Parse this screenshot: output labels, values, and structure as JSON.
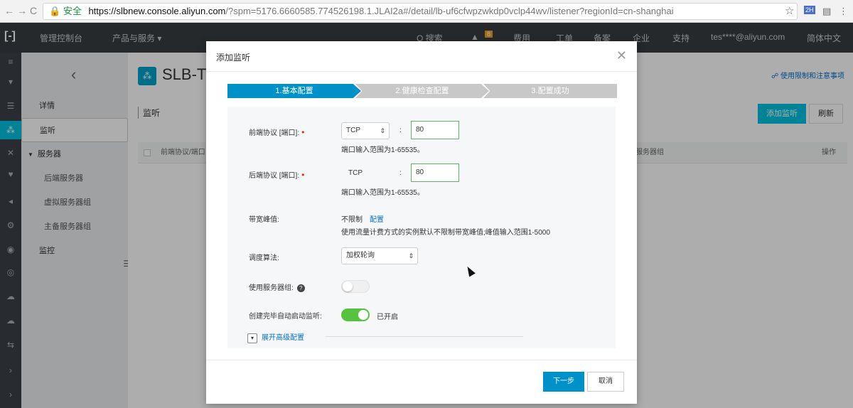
{
  "browser": {
    "back": "←",
    "forward": "→",
    "reload": "C",
    "lock": "🔒",
    "secure_label": "安全",
    "url_host": "https://slbnew.console.aliyun.com",
    "url_rest": "/?spm=5176.6660585.774526198.1.JLAI2a#/detail/lb-uf6cfwpzwkdp0vclp44wv/listener?regionId=cn-shanghai",
    "star": "☆",
    "ext1": "2H",
    "ext2": "▤",
    "menu": "⋮"
  },
  "topbar": {
    "logo": "[-]",
    "console": "管理控制台",
    "products": "产品与服务 ▾",
    "search": "Q 搜索",
    "bell": "▲",
    "bell_badge": "8",
    "fees": "费用",
    "workorder": "工单",
    "beian": "备案",
    "enterprise": "企业",
    "support": "支持",
    "user": "tes****@aliyun.com",
    "lang": "简体中文"
  },
  "rail": {
    "items": [
      "≡",
      "▾",
      "☰",
      "⁂",
      "✕",
      "♥",
      "◂",
      "⚙",
      "◉",
      "◎",
      "☁",
      "☁",
      "⇆",
      "›",
      "›"
    ]
  },
  "sidebar": {
    "back": "‹",
    "items": [
      "详情",
      "监听",
      "服务器",
      "后端服务器",
      "虚拟服务器组",
      "主备服务器组",
      "监控"
    ],
    "handle": "☰"
  },
  "main": {
    "icon": "⁂",
    "title": "SLB-TE",
    "usage_link": "☍ 使用限制和注意事项",
    "tab": "监听",
    "add_button": "添加监听",
    "refresh_button": "刷新",
    "col_protocol": "前端协议/端口",
    "col_servergroup": "服务器组",
    "col_actions": "操作"
  },
  "modal": {
    "title": "添加监听",
    "close": "✕",
    "steps": [
      "1.基本配置",
      "2.健康检查配置",
      "3.配置成功"
    ],
    "frontend": {
      "label": "前端协议 [端口]:",
      "required": "•",
      "protocol": "TCP",
      "colon": ":",
      "port": "80",
      "hint": "端口输入范围为1-65535。"
    },
    "backend": {
      "label": "后端协议 [端口]:",
      "required": "•",
      "protocol": "TCP",
      "colon": ":",
      "port": "80",
      "hint": "端口输入范围为1-65535。"
    },
    "bandwidth": {
      "label": "带宽峰值:",
      "value": "不限制",
      "config_link": "配置",
      "hint": "使用流量计费方式的实例默认不限制带宽峰值;峰值输入范围1-5000"
    },
    "algorithm": {
      "label": "调度算法:",
      "value": "加权轮询",
      "arrow": "⇕"
    },
    "server_group": {
      "label": "使用服务器组:",
      "help": "?"
    },
    "autostart": {
      "label": "创建完毕自动启动监听:",
      "status": "已开启"
    },
    "advanced": {
      "chevron": "▾",
      "label": "展开高级配置"
    },
    "next_button": "下一步",
    "cancel_button": "取消"
  },
  "colors": {
    "accent": "#00c1de",
    "primary": "#0091c8",
    "toggle_on": "#56c33e",
    "required": "#d93026"
  }
}
